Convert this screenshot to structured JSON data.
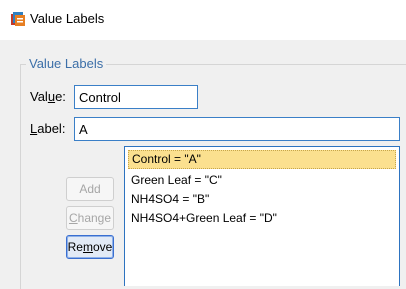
{
  "window": {
    "title": "Value Labels",
    "icon": "spss-value-labels-icon"
  },
  "group": {
    "legend": "Value Labels"
  },
  "value_field": {
    "label_pre": "Val",
    "label_mnemonic": "u",
    "label_post": "e:",
    "value": "Control"
  },
  "label_field": {
    "label_mnemonic": "L",
    "label_post": "abel:",
    "value": "A"
  },
  "buttons": {
    "add": {
      "label": "Add",
      "enabled": false
    },
    "change": {
      "label_mnemonic": "C",
      "label_post": "hange",
      "enabled": false
    },
    "remove": {
      "label_pre": "Re",
      "label_mnemonic": "m",
      "label_post": "ove",
      "enabled": true
    }
  },
  "list": {
    "selected_index": 0,
    "items": [
      "Control = \"A\"",
      "Green Leaf = \"C\"",
      "NH4SO4 = \"B\"",
      "NH4SO4+Green Leaf = \"D\""
    ]
  }
}
